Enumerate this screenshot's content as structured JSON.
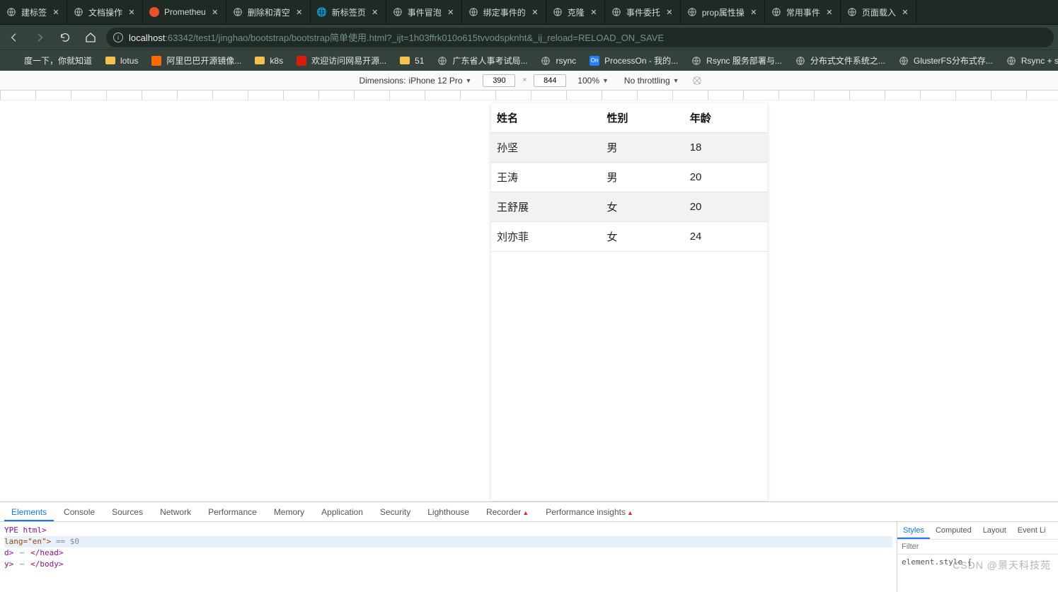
{
  "tabs": [
    {
      "label": "建标签",
      "icon": "globe"
    },
    {
      "label": "文档操作",
      "icon": "globe"
    },
    {
      "label": "Prometheu",
      "icon": "prometheus"
    },
    {
      "label": "删除和清空",
      "icon": "globe"
    },
    {
      "label": "新标签页",
      "icon": "chrome"
    },
    {
      "label": "事件冒泡",
      "icon": "globe"
    },
    {
      "label": "绑定事件的",
      "icon": "globe"
    },
    {
      "label": "克隆",
      "icon": "globe"
    },
    {
      "label": "事件委托",
      "icon": "globe"
    },
    {
      "label": "prop属性操",
      "icon": "globe"
    },
    {
      "label": "常用事件",
      "icon": "globe"
    },
    {
      "label": "页面载入",
      "icon": "globe"
    }
  ],
  "url": {
    "host": "localhost",
    "rest": ":63342/test1/jinghao/bootstrap/bootstrap简单使用.html?_ijt=1h03ffrk010o615tvvodspknht&_ij_reload=RELOAD_ON_SAVE"
  },
  "bookmarks": [
    {
      "label": "度一下，你就知道",
      "icon": "none"
    },
    {
      "label": "lotus",
      "icon": "folder"
    },
    {
      "label": "阿里巴巴开源镜像...",
      "icon": "ali"
    },
    {
      "label": "k8s",
      "icon": "folder"
    },
    {
      "label": "欢迎访问网易开源...",
      "icon": "netease"
    },
    {
      "label": "51",
      "icon": "folder"
    },
    {
      "label": "广东省人事考试局...",
      "icon": "globe"
    },
    {
      "label": "rsync",
      "icon": "globe"
    },
    {
      "label": "ProcessOn - 我的...",
      "icon": "processon"
    },
    {
      "label": "Rsync 服务部署与...",
      "icon": "globe"
    },
    {
      "label": "分布式文件系统之...",
      "icon": "globe"
    },
    {
      "label": "GlusterFS分布式存...",
      "icon": "globe"
    },
    {
      "label": "Rsync + sersy",
      "icon": "globe"
    }
  ],
  "device_toolbar": {
    "dimensions_label": "Dimensions:",
    "device": "iPhone 12 Pro",
    "width": "390",
    "height": "844",
    "zoom": "100%",
    "throttle": "No throttling"
  },
  "table": {
    "headers": [
      "姓名",
      "性别",
      "年龄"
    ],
    "rows": [
      [
        "孙坚",
        "男",
        "18"
      ],
      [
        "王涛",
        "男",
        "20"
      ],
      [
        "王舒展",
        "女",
        "20"
      ],
      [
        "刘亦菲",
        "女",
        "24"
      ]
    ]
  },
  "devtools": {
    "panels": [
      "Elements",
      "Console",
      "Sources",
      "Network",
      "Performance",
      "Memory",
      "Application",
      "Security",
      "Lighthouse",
      "Recorder",
      "Performance insights"
    ],
    "styles_tabs": [
      "Styles",
      "Computed",
      "Layout",
      "Event Li"
    ],
    "filter_placeholder": "Filter",
    "rule": "element.style {",
    "dom_lines": {
      "l0": "YPE html>",
      "l1a": "lang=\"en\">",
      "l1b": " == $0",
      "l2a": "d>",
      "l2b": "</head>",
      "l3a": "y>",
      "l3b": "</body>"
    }
  },
  "watermark": "CSDN @景天科技苑"
}
